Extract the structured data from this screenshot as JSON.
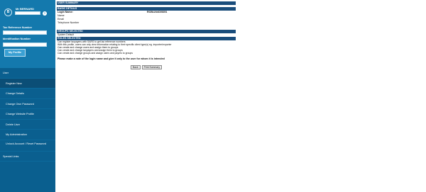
{
  "sidebar": {
    "user_name": "Mr BERNARD",
    "avatar_letter": "B",
    "help_glyph": "?",
    "tax_ref_label": "Tax Reference Number",
    "id_number_label": "Identification Number",
    "my_profile_label": "My Profile",
    "nav": [
      {
        "label": "User"
      },
      {
        "label": "Register New"
      },
      {
        "label": "Change Details"
      },
      {
        "label": "Change Own Password"
      },
      {
        "label": "Change Website Profile"
      },
      {
        "label": "Delete User"
      },
      {
        "label": "My Administration"
      },
      {
        "label": "Unlock Account / Reset Password"
      },
      {
        "label": "Special Links"
      }
    ]
  },
  "main": {
    "summary_title": "USER SUMMARY",
    "basic_details_title": "BASIC DETAILS",
    "details": [
      {
        "key": "Login Name:",
        "value": "RCB1234C05251"
      },
      {
        "key": "Name",
        "value": ""
      },
      {
        "key": "Email",
        "value": ""
      },
      {
        "key": "Telephone Number",
        "value": ""
      }
    ],
    "groups_title": "GROUPS SELECTED",
    "groups": [
      "System Default"
    ],
    "roles_title": "ROLES SELECTED",
    "roles": [
      "Can register taxpayers with SARS to get tax reference numbers",
      "With this profile, users can only view information relating to their specific client type(s) eg. importer/exporter",
      "Can create and change users and assign them to groups",
      "Can create and change taxpayers and assign them to groups",
      "Can create and change groups and assign users and payers to groups"
    ],
    "note": "Please make a note of the login name and give it only to the user for whom it is intended",
    "back_label": "Back",
    "print_label": "Print Summary"
  },
  "colors": {
    "sidebar_bg": "#0a5f8f",
    "profile_bg": "#1479ad",
    "section_bar": "#1a4d7b",
    "active_nav": "#0b4e76"
  }
}
